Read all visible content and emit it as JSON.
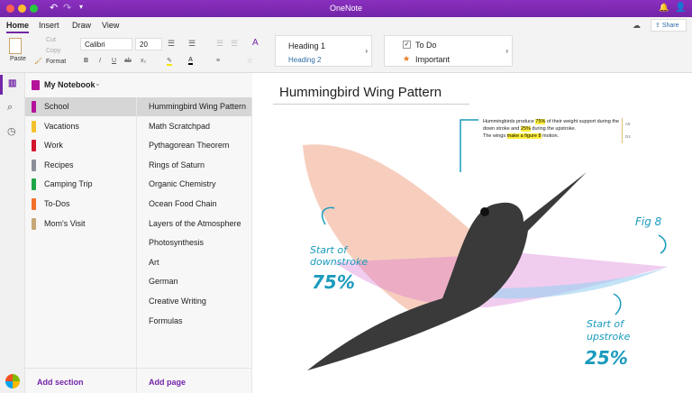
{
  "app": {
    "title": "OneNote"
  },
  "ribbon": {
    "tabs": [
      "Home",
      "Insert",
      "Draw",
      "View"
    ],
    "paste": "Paste",
    "cut": "Cut",
    "copy": "Copy",
    "format": "Format",
    "font": "Calibri",
    "size": "20",
    "bold": "B",
    "italic": "I",
    "underline": "U",
    "strike": "ab",
    "subscript": "x₂",
    "styles": [
      "Heading 1",
      "Heading 2"
    ],
    "tags": [
      "To Do",
      "Important"
    ],
    "share": "Share"
  },
  "notebook": {
    "name": "My Notebook"
  },
  "sections": [
    {
      "label": "School",
      "color": "#b4129a"
    },
    {
      "label": "Vacations",
      "color": "#f4c12e"
    },
    {
      "label": "Work",
      "color": "#d3142c"
    },
    {
      "label": "Recipes",
      "color": "#8a8f99"
    },
    {
      "label": "Camping Trip",
      "color": "#1fa647"
    },
    {
      "label": "To-Dos",
      "color": "#f0712a"
    },
    {
      "label": "Mom's Visit",
      "color": "#c8a777"
    }
  ],
  "pages": [
    "Hummingbird Wing Pattern",
    "Math Scratchpad",
    "Pythagorean Theorem",
    "Rings of Saturn",
    "Organic Chemistry",
    "Ocean Food Chain",
    "Layers of the Atmosphere",
    "Photosynthesis",
    "Art",
    "German",
    "Creative Writing",
    "Formulas"
  ],
  "footer": {
    "add_section": "Add section",
    "add_page": "Add page"
  },
  "page": {
    "title": "Hummingbird Wing Pattern",
    "note": {
      "p1": "Hummingbirds produce ",
      "h1": "75%",
      "p2": " of their weight support during the down stroke and ",
      "h2": "25%",
      "p3": " during the upstroke.",
      "p4": "The wings ",
      "h3": "make a figure 8",
      "p5": " motion."
    },
    "side_tags": [
      "A5",
      "D4"
    ],
    "annotations": {
      "down_label": "Start of downstroke",
      "down_value": "75%",
      "fig": "Fig 8",
      "up_label": "Start of upstroke",
      "up_value": "25%"
    }
  }
}
